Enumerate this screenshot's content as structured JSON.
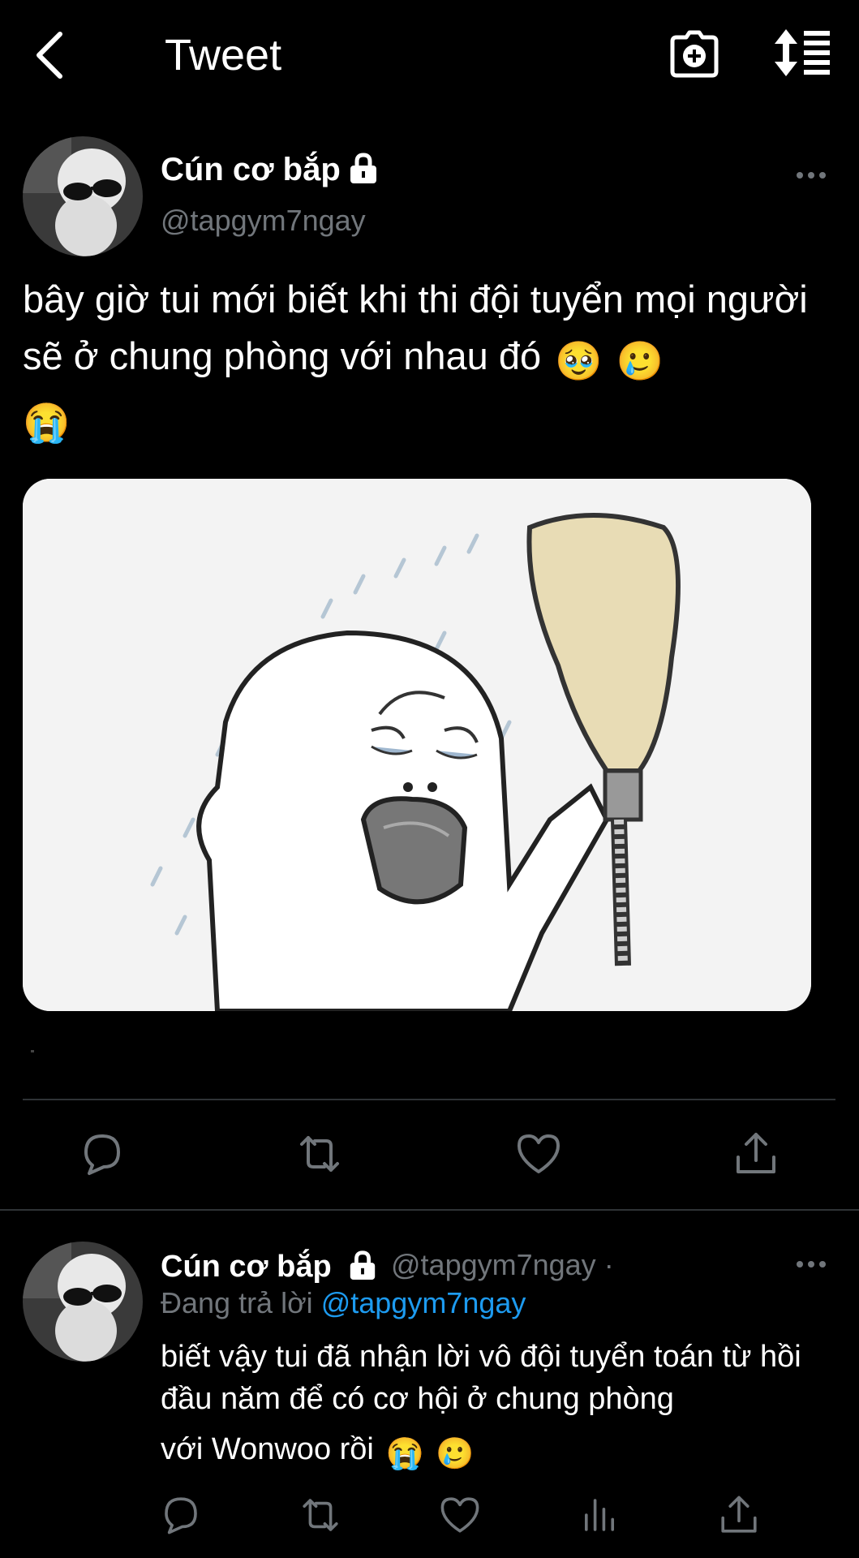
{
  "header": {
    "title": "Tweet"
  },
  "main_tweet": {
    "display_name": "Cún cơ bắp",
    "handle": "@tapgym7ngay",
    "text": "bây giờ tui mới biết khi thi đội tuyển mọi người sẽ ở chung phòng với nhau đó",
    "text_emojis": [
      "🥹",
      "🥲",
      "😭"
    ],
    "media": "crying-in-shower-meme-image"
  },
  "reply_tweet": {
    "display_name": "Cún cơ bắp",
    "handle_with_dot": "@tapgym7ngay ·",
    "replying_prefix": "Đang trả lời",
    "replying_mention": "@tapgym7ngay",
    "text_line_1_2": "biết vậy tui đã nhận lời vô đội tuyển toán từ hồi đầu năm để có cơ hội ở chung phòng",
    "text_line_3": "với Wonwoo rồi",
    "text_emojis": [
      "😭",
      "🥲"
    ]
  },
  "icons": {
    "back": "chevron-left-icon",
    "camera": "camera-plus-icon",
    "sort": "sort-icon",
    "lock": "lock-icon",
    "more": "more-icon",
    "reply": "reply-icon",
    "retweet": "retweet-icon",
    "like": "heart-icon",
    "views": "views-icon",
    "share": "share-icon"
  },
  "colors": {
    "background": "#000000",
    "text": "#ffffff",
    "secondary": "#71767b",
    "link": "#1d9bf0",
    "divider": "#2f3336"
  }
}
